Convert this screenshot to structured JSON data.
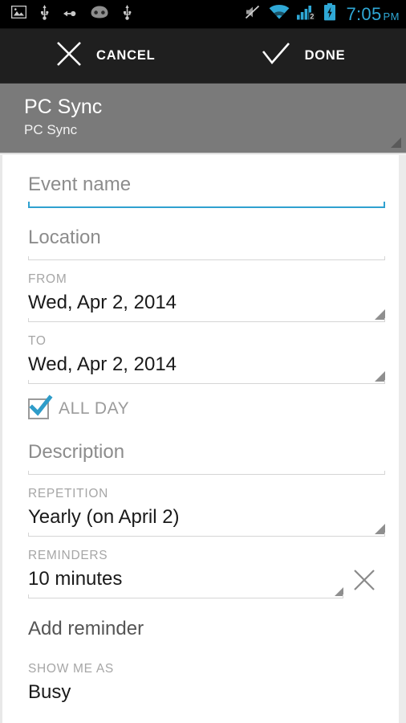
{
  "status_bar": {
    "icons_left": [
      "image-icon",
      "usb-icon",
      "usb-transfer-icon",
      "cyanogenmod-icon",
      "usb-icon"
    ],
    "icons_right": [
      "mute-icon",
      "wifi-icon",
      "signal-2g-icon",
      "battery-charging-icon"
    ],
    "time": "7:05",
    "ampm": "PM",
    "accent_color": "#2FA8D6"
  },
  "action_bar": {
    "cancel_label": "CANCEL",
    "cancel_icon": "close-icon",
    "done_label": "DONE",
    "done_icon": "check-icon",
    "background": "#1F1F1F"
  },
  "account": {
    "name": "PC Sync",
    "calendar": "PC Sync",
    "background": "#7A7A7A"
  },
  "form": {
    "event_name": {
      "label": "Event name",
      "value": "",
      "placeholder": "Event name",
      "focused": true
    },
    "location": {
      "label": "Location",
      "value": "",
      "placeholder": "Location"
    },
    "from": {
      "label": "FROM",
      "value": "Wed, Apr 2, 2014"
    },
    "to": {
      "label": "TO",
      "value": "Wed, Apr 2, 2014"
    },
    "all_day": {
      "label": "ALL DAY",
      "checked": true,
      "check_color": "#2E9CC9"
    },
    "description": {
      "label": "Description",
      "value": "",
      "placeholder": "Description"
    },
    "repetition": {
      "label": "REPETITION",
      "value": "Yearly (on April 2)"
    },
    "reminders": {
      "label": "REMINDERS",
      "value": "10 minutes",
      "remove_icon": "close-icon"
    },
    "add_reminder": {
      "label": "Add reminder"
    },
    "show_me_as": {
      "label": "SHOW ME AS",
      "value": "Busy"
    }
  },
  "colors": {
    "accent": "#2FA1D0",
    "field_rule": "#d5d5d5",
    "label_gray": "#a6a6a6"
  }
}
